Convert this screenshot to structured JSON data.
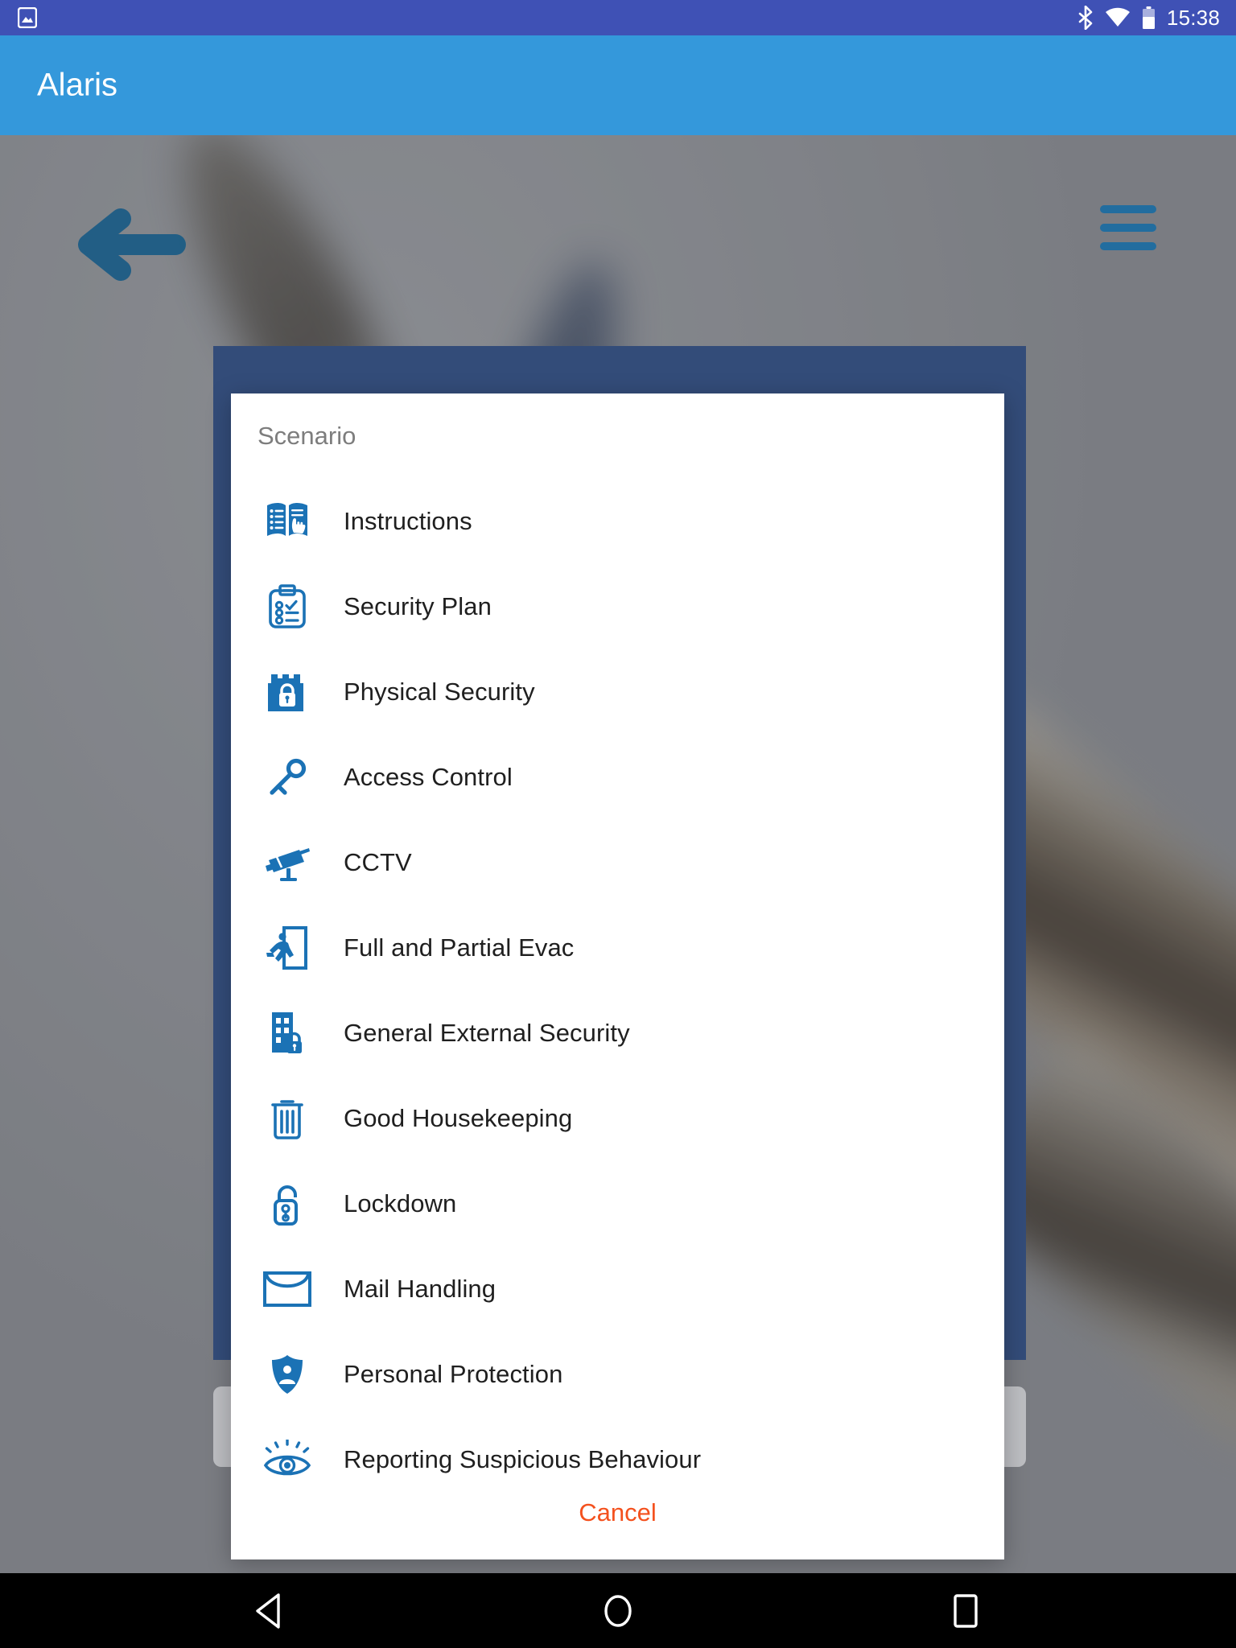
{
  "status_bar": {
    "background": "#3f51b5",
    "time": "15:38",
    "icons": [
      "image-notification-icon",
      "bluetooth-icon",
      "wifi-icon",
      "battery-icon"
    ]
  },
  "app_bar": {
    "title": "Alaris",
    "background": "#3498db"
  },
  "background_screen": {
    "back_button": "back-arrow-icon",
    "menu_button": "hamburger-menu-icon",
    "accent": "#1b6ca2"
  },
  "dialog": {
    "title": "Scenario",
    "backdrop_panel_color": "#334c79",
    "icon_color": "#1b72b5",
    "items": [
      {
        "label": "Instructions",
        "icon": "open-book-hand-icon"
      },
      {
        "label": "Security Plan",
        "icon": "clipboard-checklist-icon"
      },
      {
        "label": "Physical Security",
        "icon": "fortress-lock-icon"
      },
      {
        "label": "Access Control",
        "icon": "key-icon"
      },
      {
        "label": "CCTV",
        "icon": "cctv-camera-icon"
      },
      {
        "label": "Full and Partial Evac",
        "icon": "running-exit-icon"
      },
      {
        "label": "General External Security",
        "icon": "building-lock-icon"
      },
      {
        "label": "Good Housekeeping",
        "icon": "trash-bin-icon"
      },
      {
        "label": "Lockdown",
        "icon": "open-padlock-icon"
      },
      {
        "label": "Mail Handling",
        "icon": "envelope-icon"
      },
      {
        "label": "Personal Protection",
        "icon": "shield-person-icon"
      },
      {
        "label": "Reporting Suspicious Behaviour",
        "icon": "eye-alert-icon"
      }
    ],
    "cancel_label": "Cancel",
    "cancel_color": "#f4511e"
  },
  "nav_bar": {
    "background": "#000000",
    "buttons": [
      "back-triangle-icon",
      "home-circle-icon",
      "recents-square-icon"
    ]
  }
}
